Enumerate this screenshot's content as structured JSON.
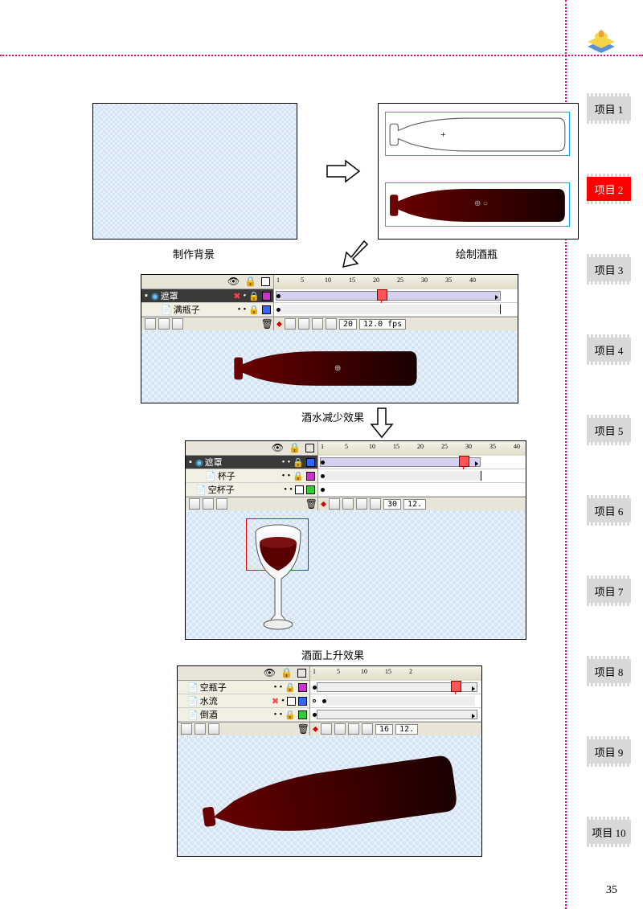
{
  "page_number": "35",
  "sidebar": {
    "tabs": [
      {
        "label": "项目 1",
        "active": false
      },
      {
        "label": "项目 2",
        "active": true
      },
      {
        "label": "项目 3",
        "active": false
      },
      {
        "label": "项目 4",
        "active": false
      },
      {
        "label": "项目 5",
        "active": false
      },
      {
        "label": "项目 6",
        "active": false
      },
      {
        "label": "项目 7",
        "active": false
      },
      {
        "label": "项目 8",
        "active": false
      },
      {
        "label": "项目 9",
        "active": false
      },
      {
        "label": "项目 10",
        "active": false
      }
    ]
  },
  "figures": {
    "fig1_caption": "制作背景",
    "fig2_caption": "绘制酒瓶",
    "fig3_caption": "酒水减少效果",
    "fig4_caption": "酒面上升效果"
  },
  "timeline3": {
    "ruler": [
      "1",
      "5",
      "10",
      "15",
      "20",
      "25",
      "30",
      "35",
      "40"
    ],
    "layers": [
      {
        "name": "遮罩",
        "selected": true,
        "locked": true,
        "color": "#CC33CC"
      },
      {
        "name": "满瓶子",
        "selected": false,
        "locked": true,
        "color": "#3366FF"
      }
    ],
    "frame": "20",
    "fps": "12.0 fps"
  },
  "timeline4": {
    "ruler": [
      "1",
      "5",
      "10",
      "15",
      "20",
      "25",
      "30",
      "35",
      "40"
    ],
    "layers": [
      {
        "name": "遮罩",
        "selected": true,
        "locked": true,
        "color": "#3366FF"
      },
      {
        "name": "杯子",
        "selected": false,
        "locked": true,
        "color": "#CC33CC"
      },
      {
        "name": "空杯子",
        "selected": false,
        "locked": false,
        "color": "#33CC33"
      }
    ],
    "frame": "30",
    "fps": "12."
  },
  "timeline5": {
    "ruler": [
      "1",
      "5",
      "10",
      "15",
      "2"
    ],
    "layers": [
      {
        "name": "空瓶子",
        "selected": false,
        "locked": true,
        "color": "#CC33CC"
      },
      {
        "name": "水流",
        "selected": false,
        "locked": false,
        "color": "#3366FF",
        "hidden": true
      },
      {
        "name": "倒酒",
        "selected": false,
        "locked": true,
        "color": "#33CC33"
      }
    ],
    "frame": "16",
    "fps": "12."
  }
}
